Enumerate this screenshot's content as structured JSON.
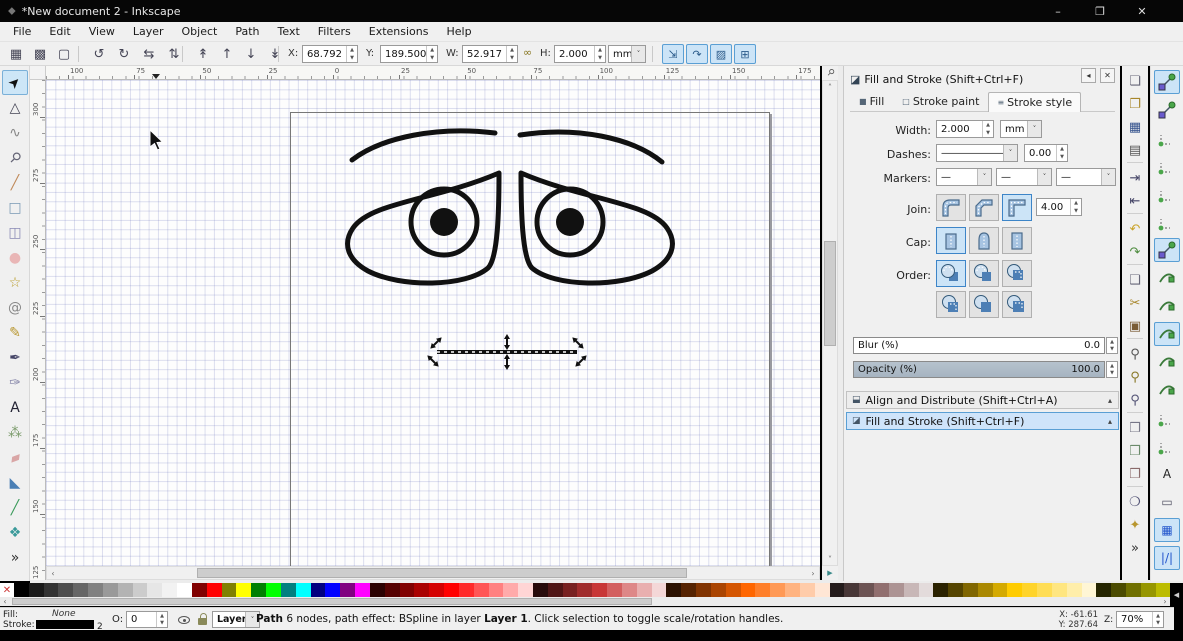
{
  "window": {
    "title": "*New document 2 - Inkscape",
    "icon": "⬥",
    "minimize": "–",
    "restore": "❐",
    "close": "✕"
  },
  "menu": {
    "items": [
      "File",
      "Edit",
      "View",
      "Layer",
      "Object",
      "Path",
      "Text",
      "Filters",
      "Extensions",
      "Help"
    ]
  },
  "tool_controls": {
    "buttons": [
      {
        "name": "select-all-button",
        "glyph": "▦"
      },
      {
        "name": "select-all-layers-button",
        "glyph": "▩"
      },
      {
        "name": "deselect-button",
        "glyph": "▢"
      },
      {
        "name": "rotate-ccw-button",
        "glyph": "↺"
      },
      {
        "name": "rotate-cw-button",
        "glyph": "↻"
      },
      {
        "name": "flip-horizontal-button",
        "glyph": "⇆"
      },
      {
        "name": "flip-vertical-button",
        "glyph": "⇅"
      },
      {
        "name": "raise-to-top-button",
        "glyph": "↟"
      },
      {
        "name": "raise-button",
        "glyph": "↑"
      },
      {
        "name": "lower-button",
        "glyph": "↓"
      },
      {
        "name": "lower-to-bottom-button",
        "glyph": "↡"
      }
    ],
    "x_label": "X:",
    "x_value": "68.792",
    "y_label": "Y:",
    "y_value": "189.500",
    "w_label": "W:",
    "w_value": "52.917",
    "lock_icon": "∞",
    "h_label": "H:",
    "h_value": "2.000",
    "unit": "mm",
    "toggles": [
      {
        "name": "scale-stroke-toggle",
        "glyph": "⇲",
        "active": true
      },
      {
        "name": "scale-corners-toggle",
        "glyph": "↷",
        "active": true
      },
      {
        "name": "move-gradients-toggle",
        "glyph": "▨",
        "active": true
      },
      {
        "name": "move-patterns-toggle",
        "glyph": "⊞",
        "active": true
      }
    ]
  },
  "toolbox": {
    "items": [
      {
        "name": "selector-tool",
        "glyph": "➤",
        "color": "#111",
        "rot": "-45",
        "active": true
      },
      {
        "name": "node-tool",
        "glyph": "△",
        "color": "#445",
        "rot": "",
        "active": false
      },
      {
        "name": "tweak-tool",
        "glyph": "∿",
        "color": "#888",
        "rot": "",
        "active": false
      },
      {
        "name": "zoom-tool",
        "glyph": "⚲",
        "color": "#667",
        "rot": "45",
        "active": false
      },
      {
        "name": "measure-tool",
        "glyph": "╱",
        "color": "#c08a5a",
        "rot": "",
        "active": false
      },
      {
        "name": "rectangle-tool",
        "glyph": "□",
        "color": "#7a9ab5",
        "rot": "",
        "active": false
      },
      {
        "name": "box3d-tool",
        "glyph": "◫",
        "color": "#8a8ab5",
        "rot": "",
        "active": false
      },
      {
        "name": "ellipse-tool",
        "glyph": "●",
        "color": "#e9b6b6",
        "rot": "",
        "active": false
      },
      {
        "name": "star-tool",
        "glyph": "☆",
        "color": "#b89b2a",
        "rot": "",
        "active": false
      },
      {
        "name": "spiral-tool",
        "glyph": "@",
        "color": "#888",
        "rot": "",
        "active": false
      },
      {
        "name": "pencil-tool",
        "glyph": "✎",
        "color": "#b8962e",
        "rot": "",
        "active": false
      },
      {
        "name": "pen-tool",
        "glyph": "✒",
        "color": "#446",
        "rot": "",
        "active": false
      },
      {
        "name": "calligraphy-tool",
        "glyph": "✑",
        "color": "#88a",
        "rot": "",
        "active": false
      },
      {
        "name": "text-tool",
        "glyph": "A",
        "color": "#223",
        "rot": "",
        "active": false
      },
      {
        "name": "spray-tool",
        "glyph": "⁂",
        "color": "#7a9a6a",
        "rot": "",
        "active": false
      },
      {
        "name": "eraser-tool",
        "glyph": "▰",
        "color": "#d9a6a6",
        "rot": "-20",
        "active": false
      },
      {
        "name": "paint-bucket-tool",
        "glyph": "◣",
        "color": "#4a7fb5",
        "rot": "",
        "active": false
      },
      {
        "name": "gradient-tool",
        "glyph": "╱",
        "color": "#3a9a5a",
        "rot": "",
        "active": false
      },
      {
        "name": "mesh-tool",
        "glyph": "❖",
        "color": "#3a9a9a",
        "rot": "",
        "active": false
      },
      {
        "name": "toolbox-overflow",
        "glyph": "»",
        "color": "#333",
        "rot": "",
        "active": false
      }
    ]
  },
  "rulers": {
    "top_labels": [
      "100",
      "75",
      "50",
      "25",
      "0",
      "25",
      "50",
      "75",
      "100",
      "125",
      "150",
      "175"
    ],
    "left_labels": [
      "300",
      "275",
      "250",
      "225",
      "200",
      "175",
      "150",
      "125"
    ]
  },
  "canvas": {
    "zoom_lock_icon": "⚲",
    "scroll_up": "˄",
    "scroll_down": "˅",
    "scroll_left": "‹",
    "scroll_right": "›",
    "corner_icon": "▶"
  },
  "dock": {
    "fill_stroke": {
      "title": "Fill and Stroke (Shift+Ctrl+F)",
      "title_icon": "◪",
      "dock_button": "◂",
      "close_button": "✕",
      "tabs": [
        {
          "label": "Fill",
          "icon": "■",
          "active": false
        },
        {
          "label": "Stroke paint",
          "icon": "□",
          "active": false
        },
        {
          "label": "Stroke style",
          "icon": "≡",
          "active": true
        }
      ],
      "width_label": "Width:",
      "width_value": "2.000",
      "width_unit": "mm",
      "dashes_label": "Dashes:",
      "dash_preview": "———————",
      "dash_offset": "0.00",
      "markers_label": "Markers:",
      "marker_values": [
        "—",
        "—",
        "—"
      ],
      "join_label": "Join:",
      "miter_limit": "4.00",
      "join_buttons": [
        {
          "name": "join-round-button",
          "active": false
        },
        {
          "name": "join-bevel-button",
          "active": false
        },
        {
          "name": "join-miter-button",
          "active": true
        }
      ],
      "cap_label": "Cap:",
      "cap_buttons": [
        {
          "name": "cap-butt-button",
          "active": true
        },
        {
          "name": "cap-round-button",
          "active": false
        },
        {
          "name": "cap-square-button",
          "active": false
        }
      ],
      "order_label": "Order:",
      "order_buttons": [
        {
          "name": "order-fill-stroke-markers-button",
          "active": true
        },
        {
          "name": "order-fill-markers-stroke-button",
          "active": false
        },
        {
          "name": "order-stroke-fill-markers-button",
          "active": false
        },
        {
          "name": "order-stroke-markers-fill-button",
          "active": false
        },
        {
          "name": "order-markers-fill-stroke-button",
          "active": false
        },
        {
          "name": "order-markers-stroke-fill-button",
          "active": false
        }
      ],
      "blur_label": "Blur (%)",
      "blur_value": "0.0",
      "opacity_label": "Opacity (%)",
      "opacity_value": "100.0"
    },
    "docked_panels": [
      {
        "name": "align-distribute-panel-header",
        "label": "Align and Distribute (Shift+Ctrl+A)",
        "icon": "⬓",
        "collapse_icon": "▴",
        "active": false
      },
      {
        "name": "fill-stroke-panel-header",
        "label": "Fill and Stroke (Shift+Ctrl+F)",
        "icon": "◪",
        "collapse_icon": "▴",
        "active": true
      }
    ]
  },
  "commands": {
    "items": [
      {
        "name": "new-document-button",
        "glyph": "❏",
        "color": "#667"
      },
      {
        "name": "open-document-button",
        "glyph": "❐",
        "color": "#a8862a"
      },
      {
        "name": "save-button",
        "glyph": "▦",
        "color": "#33518c"
      },
      {
        "name": "print-button",
        "glyph": "▤",
        "color": "#555"
      },
      {
        "name": "sep"
      },
      {
        "name": "import-button",
        "glyph": "⇥",
        "color": "#446"
      },
      {
        "name": "export-button",
        "glyph": "⇤",
        "color": "#446"
      },
      {
        "name": "sep"
      },
      {
        "name": "undo-button",
        "glyph": "↶",
        "color": "#caa42a"
      },
      {
        "name": "redo-button",
        "glyph": "↷",
        "color": "#4e8c3f"
      },
      {
        "name": "sep"
      },
      {
        "name": "copy-button",
        "glyph": "❑",
        "color": "#667"
      },
      {
        "name": "cut-button",
        "glyph": "✂",
        "color": "#a8862a"
      },
      {
        "name": "paste-button",
        "glyph": "▣",
        "color": "#7a5c35"
      },
      {
        "name": "sep"
      },
      {
        "name": "zoom-selection-button",
        "glyph": "⚲",
        "color": "#555"
      },
      {
        "name": "zoom-drawing-button",
        "glyph": "⚲",
        "color": "#8a7a2a"
      },
      {
        "name": "zoom-page-button",
        "glyph": "⚲",
        "color": "#557"
      },
      {
        "name": "sep"
      },
      {
        "name": "duplicate-button",
        "glyph": "❒",
        "color": "#778"
      },
      {
        "name": "clone-button",
        "glyph": "❒",
        "color": "#6a8a6a"
      },
      {
        "name": "unlink-clone-button",
        "glyph": "❒",
        "color": "#8a6a6a"
      },
      {
        "name": "sep"
      },
      {
        "name": "group-button",
        "glyph": "❍",
        "color": "#557"
      },
      {
        "name": "ungroup-button",
        "glyph": "✦",
        "color": "#b8962e"
      },
      {
        "name": "commands-overflow",
        "glyph": "»",
        "color": "#333"
      }
    ]
  },
  "snapbar": {
    "items": [
      {
        "name": "snap-toggle",
        "kind": "diag",
        "active": true
      },
      {
        "name": "snap-bbox-toggle",
        "kind": "diag",
        "active": false
      },
      {
        "name": "snap-bbox-edges-toggle",
        "kind": "dots",
        "active": false
      },
      {
        "name": "snap-bbox-corners-toggle",
        "kind": "dots",
        "active": false
      },
      {
        "name": "snap-bbox-edge-midpoints-toggle",
        "kind": "dots",
        "active": false
      },
      {
        "name": "snap-bbox-centers-toggle",
        "kind": "dots",
        "active": false
      },
      {
        "name": "snap-nodes-toggle",
        "kind": "diag",
        "active": true
      },
      {
        "name": "snap-paths-toggle",
        "kind": "curve",
        "active": false
      },
      {
        "name": "snap-path-intersections-toggle",
        "kind": "curve",
        "active": false
      },
      {
        "name": "snap-cusp-nodes-toggle",
        "kind": "curve",
        "active": true
      },
      {
        "name": "snap-smooth-nodes-toggle",
        "kind": "curve",
        "active": false
      },
      {
        "name": "snap-midpoints-toggle",
        "kind": "curve",
        "active": false
      },
      {
        "name": "snap-object-centers-toggle",
        "kind": "dots",
        "active": false
      },
      {
        "name": "snap-rotation-centers-toggle",
        "kind": "dots",
        "active": false
      },
      {
        "name": "snap-text-baseline-toggle",
        "kind": "char",
        "glyph": "A",
        "color": "#222",
        "active": false
      },
      {
        "name": "snap-page-border-toggle",
        "kind": "char",
        "glyph": "▭",
        "color": "#556",
        "active": false
      },
      {
        "name": "snap-grid-toggle",
        "kind": "char",
        "glyph": "▦",
        "color": "#2255cc",
        "active": true
      },
      {
        "name": "snap-guides-toggle",
        "kind": "char",
        "glyph": "|/|",
        "color": "#2255cc",
        "active": true
      }
    ]
  },
  "palette": {
    "none_label": "✕",
    "colors": [
      "#000000",
      "#1a1a1a",
      "#333333",
      "#4d4d4d",
      "#666666",
      "#808080",
      "#999999",
      "#b3b3b3",
      "#cccccc",
      "#e6e6e6",
      "#f2f2f2",
      "#ffffff",
      "#800000",
      "#ff0000",
      "#808000",
      "#ffff00",
      "#008000",
      "#00ff00",
      "#008080",
      "#00ffff",
      "#000080",
      "#0000ff",
      "#800080",
      "#ff00ff",
      "#2b0000",
      "#550000",
      "#800000",
      "#aa0000",
      "#d40000",
      "#ff0000",
      "#ff2a2a",
      "#ff5555",
      "#ff8080",
      "#ffaaaa",
      "#ffd5d5",
      "#280b0b",
      "#501616",
      "#782121",
      "#a02c2c",
      "#c83737",
      "#d35f5f",
      "#de8787",
      "#e9afaf",
      "#f4d7d7",
      "#2b1100",
      "#552200",
      "#803300",
      "#aa4400",
      "#d45500",
      "#ff6600",
      "#ff7f2a",
      "#ff9955",
      "#ffb380",
      "#ffccaa",
      "#ffe6d5",
      "#241c1c",
      "#483737",
      "#6c5353",
      "#916f6f",
      "#ac9393",
      "#c8b7b7",
      "#e3dbdb",
      "#2b2200",
      "#554400",
      "#806600",
      "#aa8800",
      "#d4aa00",
      "#ffcc00",
      "#ffd42a",
      "#ffdd55",
      "#ffe680",
      "#ffeeaa",
      "#fff6d5",
      "#252500",
      "#4b4b00",
      "#707000",
      "#969600",
      "#bcbc00"
    ],
    "menu_arrow": "◀"
  },
  "statusbar": {
    "fill_label": "Fill:",
    "fill_value": "None",
    "stroke_label": "Stroke:",
    "stroke_color": "#000000",
    "stroke_width": "2",
    "opacity_label": "O:",
    "opacity_value": "0",
    "layer_value": "Layer 1",
    "message_bold1": "Path",
    "message_mid": " 6 nodes, path effect: BSpline in layer ",
    "message_bold2": "Layer 1",
    "message_tail": ". Click selection to toggle scale/rotation handles.",
    "x_label": "X:",
    "x_value": "-61.61",
    "y_label": "Y:",
    "y_value": "287.64",
    "z_label": "Z:",
    "zoom_value": "70%"
  }
}
